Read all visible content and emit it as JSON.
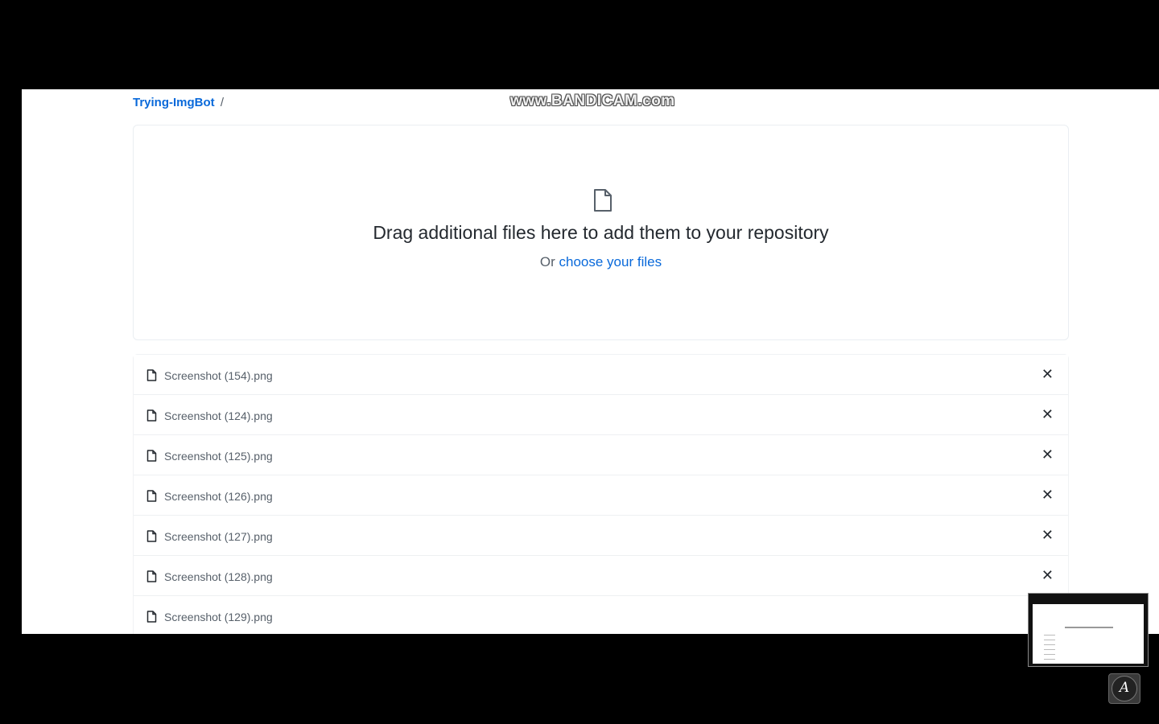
{
  "breadcrumb": {
    "repo": "Trying-ImgBot",
    "separator": "/"
  },
  "watermark": "www.BANDICAM.com",
  "dropzone": {
    "title": "Drag additional files here to add them to your repository",
    "prefix": "Or",
    "link": "choose your files"
  },
  "files": [
    {
      "name": "Screenshot (154).png"
    },
    {
      "name": "Screenshot (124).png"
    },
    {
      "name": "Screenshot (125).png"
    },
    {
      "name": "Screenshot (126).png"
    },
    {
      "name": "Screenshot (127).png"
    },
    {
      "name": "Screenshot (128).png"
    },
    {
      "name": "Screenshot (129).png"
    }
  ],
  "remove_glyph": "✕",
  "pen_glyph": "A",
  "colors": {
    "link": "#0969da",
    "text": "#24292f",
    "muted": "#57606a",
    "background": "#000000"
  }
}
